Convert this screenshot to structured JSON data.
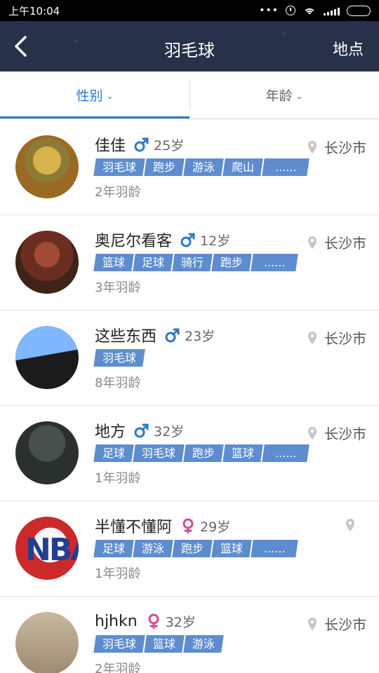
{
  "status_bar": {
    "time": "上午10:04",
    "icons": [
      "more-dots-icon",
      "alarm-icon",
      "wifi-icon",
      "signal-icon",
      "battery-icon"
    ]
  },
  "header": {
    "title": "羽毛球",
    "location_action": "地点",
    "back_icon": "back-arrow-icon",
    "background_color": "#28314a"
  },
  "filters": [
    {
      "label": "性别",
      "active": true
    },
    {
      "label": "年龄",
      "active": false
    }
  ],
  "users": [
    {
      "name": "佳佳",
      "gender": "male",
      "age": "25岁",
      "city": "长沙市",
      "tags": [
        "羽毛球",
        "跑步",
        "游泳",
        "爬山",
        "......"
      ],
      "experience": "2年羽龄"
    },
    {
      "name": "奥尼尔看客",
      "gender": "male",
      "age": "12岁",
      "city": "长沙市",
      "tags": [
        "篮球",
        "足球",
        "骑行",
        "跑步",
        "......"
      ],
      "experience": "3年羽龄"
    },
    {
      "name": "这些东西",
      "gender": "male",
      "age": "23岁",
      "city": "长沙市",
      "tags": [
        "羽毛球"
      ],
      "experience": "8年羽龄"
    },
    {
      "name": "地方",
      "gender": "male",
      "age": "32岁",
      "city": "长沙市",
      "tags": [
        "足球",
        "羽毛球",
        "跑步",
        "篮球",
        "......"
      ],
      "experience": "1年羽龄"
    },
    {
      "name": "半懂不懂阿",
      "gender": "female",
      "age": "29岁",
      "city": "",
      "tags": [
        "足球",
        "游泳",
        "跑步",
        "篮球",
        "......"
      ],
      "experience": "1年羽龄"
    },
    {
      "name": "hjhkn",
      "gender": "female",
      "age": "32岁",
      "city": "长沙市",
      "tags": [
        "羽毛球",
        "篮球",
        "游泳"
      ],
      "experience": "2年羽龄"
    }
  ],
  "colors": {
    "accent": "#2c7ac8",
    "tag": "#5d8dcf",
    "male": "#2f78c4",
    "female": "#d34b8f"
  }
}
